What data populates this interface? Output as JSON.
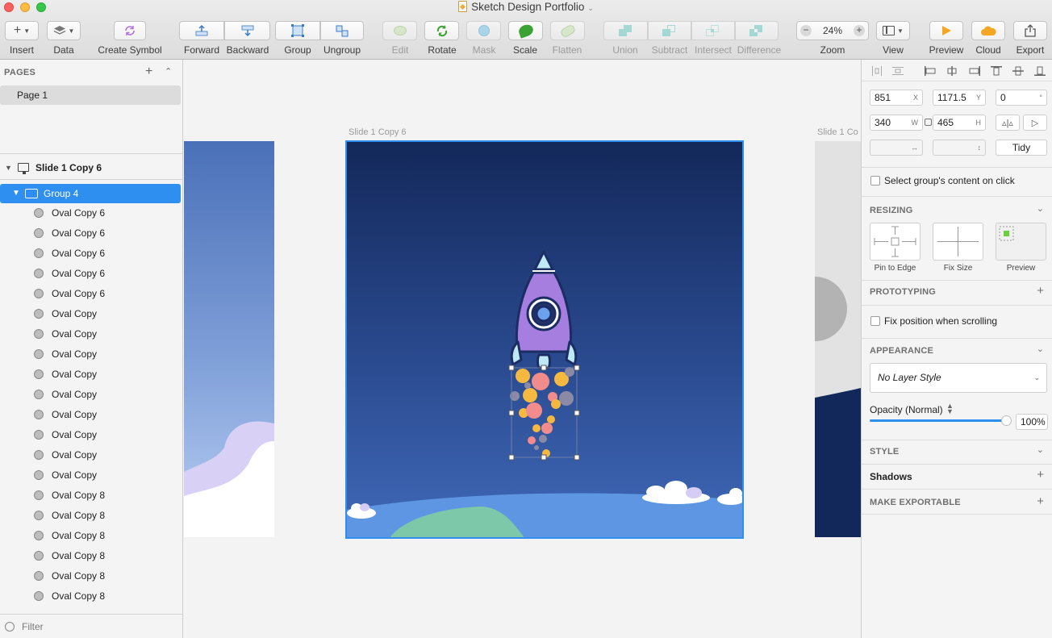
{
  "window": {
    "title": "Sketch Design Portfolio"
  },
  "toolbar": {
    "insert": "Insert",
    "data": "Data",
    "create_symbol": "Create Symbol",
    "forward": "Forward",
    "backward": "Backward",
    "group": "Group",
    "ungroup": "Ungroup",
    "edit": "Edit",
    "rotate": "Rotate",
    "mask": "Mask",
    "scale": "Scale",
    "flatten": "Flatten",
    "union": "Union",
    "subtract": "Subtract",
    "intersect": "Intersect",
    "difference": "Difference",
    "zoom_value": "24%",
    "zoom": "Zoom",
    "view": "View",
    "preview": "Preview",
    "cloud": "Cloud",
    "export": "Export"
  },
  "sidebar": {
    "pages_header": "PAGES",
    "pages": [
      "Page 1"
    ],
    "artboard": "Slide 1 Copy 6",
    "group": "Group 4",
    "layers": [
      "Oval Copy 6",
      "Oval Copy 6",
      "Oval Copy 6",
      "Oval Copy 6",
      "Oval Copy 6",
      "Oval Copy",
      "Oval Copy",
      "Oval Copy",
      "Oval Copy",
      "Oval Copy",
      "Oval Copy",
      "Oval Copy",
      "Oval Copy",
      "Oval Copy",
      "Oval Copy 8",
      "Oval Copy 8",
      "Oval Copy 8",
      "Oval Copy 8",
      "Oval Copy 8",
      "Oval Copy 8"
    ],
    "filter_label": "Filter"
  },
  "canvas": {
    "artboard_main_label": "Slide 1 Copy 6",
    "artboard_right_label": "Slide 1 Co"
  },
  "inspector": {
    "x": "851",
    "x_label": "X",
    "y": "1171.5",
    "y_label": "Y",
    "rotation": "0",
    "rotation_unit": "°",
    "w": "340",
    "w_label": "W",
    "h": "465",
    "h_label": "H",
    "tidy": "Tidy",
    "select_group_content": "Select group's content on click",
    "resizing": "RESIZING",
    "pin_to_edge": "Pin to Edge",
    "fix_size": "Fix Size",
    "preview": "Preview",
    "prototyping": "PROTOTYPING",
    "fix_position": "Fix position when scrolling",
    "appearance": "APPEARANCE",
    "layer_style": "No Layer Style",
    "opacity_label": "Opacity (Normal)",
    "opacity_value": "100%",
    "opacity_fraction": 1.0,
    "style": "STYLE",
    "shadows": "Shadows",
    "make_exportable": "MAKE EXPORTABLE"
  },
  "colors": {
    "selection_blue": "#2f8ff0",
    "night_top": "#13285a",
    "night_bottom": "#3f66b3",
    "rocket_purple": "#a57ee0",
    "ground_blue": "#5e96e3",
    "hill_green": "#7cc8a8"
  }
}
